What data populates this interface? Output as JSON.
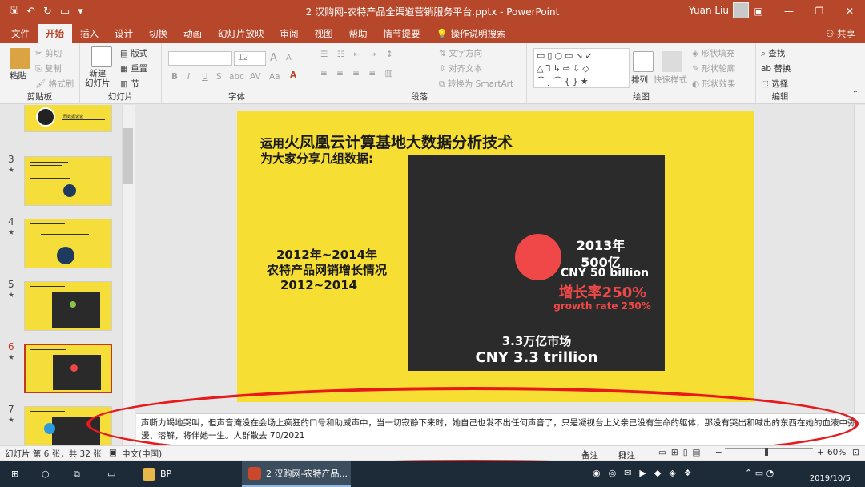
{
  "app": {
    "window_title": "2 汉购网-农特产品全渠道营销服务平台.pptx - PowerPoint",
    "user_name": "Yuan Liu",
    "share_label": "共享"
  },
  "menu_tabs": [
    "文件",
    "开始",
    "插入",
    "设计",
    "切换",
    "动画",
    "幻灯片放映",
    "审阅",
    "视图",
    "帮助",
    "情节提要",
    "操作说明搜索"
  ],
  "active_tab": "开始",
  "ribbon": {
    "clipboard": {
      "paste": "粘贴",
      "cut": "剪切",
      "copy": "复制",
      "format_painter": "格式刷",
      "group": "剪贴板"
    },
    "slides": {
      "new_slide": "新建\n幻灯片",
      "layout": "版式",
      "reset": "重置",
      "section": "节",
      "group": "幻灯片"
    },
    "font": {
      "size_value": "12",
      "group": "字体",
      "bold": "B",
      "italic": "I",
      "underline": "U",
      "strike": "S",
      "shadow": "abc",
      "spacing": "AV",
      "case": "Aa",
      "grow": "A",
      "shrink": "A"
    },
    "paragraph": {
      "text_direction": "文字方向",
      "align_text": "对齐文本",
      "smartart": "转换为 SmartArt",
      "group": "段落"
    },
    "drawing": {
      "arrange": "排列",
      "quick_styles": "快速样式",
      "shape_fill": "形状填充",
      "shape_outline": "形状轮廓",
      "shape_effects": "形状效果",
      "group": "绘图"
    },
    "editing": {
      "find": "查找",
      "replace": "替换",
      "select": "选择",
      "group": "编辑"
    }
  },
  "thumbnails": [
    {
      "num": "",
      "caption": "而数据说说"
    },
    {
      "num": "3",
      "caption": ""
    },
    {
      "num": "4",
      "caption": ""
    },
    {
      "num": "5",
      "caption": ""
    },
    {
      "num": "6",
      "caption": ""
    },
    {
      "num": "7",
      "caption": ""
    }
  ],
  "slide": {
    "title_prefix": "运用",
    "title_main": "火凤凰云计算基地大数据分析技术",
    "subtitle": "为大家分享几组数据:",
    "left_line1": "2012年~2014年",
    "left_line2": "农特产品网销增长情况",
    "left_line3": "2012~2014",
    "year": "2013年",
    "amount": "500亿",
    "amount_en": "CNY 50 billion",
    "growth": "增长率250%",
    "growth_en": "growth rate 250%",
    "market": "3.3万亿市场",
    "market_en": "CNY 3.3 trillion",
    "colors": {
      "background": "#f6df32",
      "box": "#2b2b2b",
      "accent": "#f04848"
    }
  },
  "notes": "声嘶力竭地哭叫，但声音淹没在会场上疯狂的口号和助威声中，当一切寂静下来时，她自己也发不出任何声音了，只是凝视台上父亲已没有生命的躯体，那没有哭出和喊出的东西在她的血液中弥漫、溶解，将伴她一生。人群散去 70/2021",
  "status": {
    "slide_info": "幻灯片 第 6 张，共 32 张",
    "language": "中文(中国)",
    "notes_btn": "备注",
    "comments_btn": "批注",
    "zoom": "60%"
  },
  "taskbar": {
    "app1": "BP",
    "app2": "2 汉购网-农特产品...",
    "date": "2019/10/5"
  }
}
